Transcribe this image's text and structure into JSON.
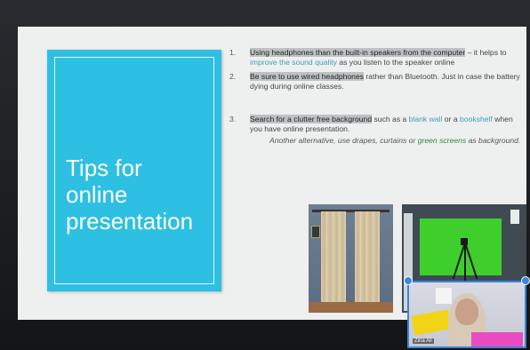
{
  "slide": {
    "title_lines": [
      "Tips for",
      "online",
      "presentation"
    ],
    "tips": [
      {
        "number": "1.",
        "highlight": "Using headphones than the built-in speakers from the computer",
        "rest_a": " – it helps to ",
        "accent": "improve the sound quality",
        "rest_b": " as you listen to the speaker online"
      },
      {
        "number": "2.",
        "highlight": "Be sure to use wired headphones",
        "rest_a": " rather than Bluetooth. Just in case the battery dying during online classes."
      },
      {
        "number": "3.",
        "highlight": "Search for a clutter free background",
        "rest_a": " such as a ",
        "accent1": "blank wall",
        "rest_b": " or a ",
        "accent2": "bookshelf",
        "rest_c": " when you have online presentation.",
        "note_a": "Another alternative, use drapes, curtains or ",
        "note_green": "green screens",
        "note_b": " as background."
      }
    ]
  },
  "video_call": {
    "participant_name": "Zina Ali"
  },
  "colors": {
    "title_panel": "#2ec0e2",
    "accent_text": "#3f9fb4",
    "green_text": "#2f8a3a",
    "camera_border": "#3b86d9"
  }
}
